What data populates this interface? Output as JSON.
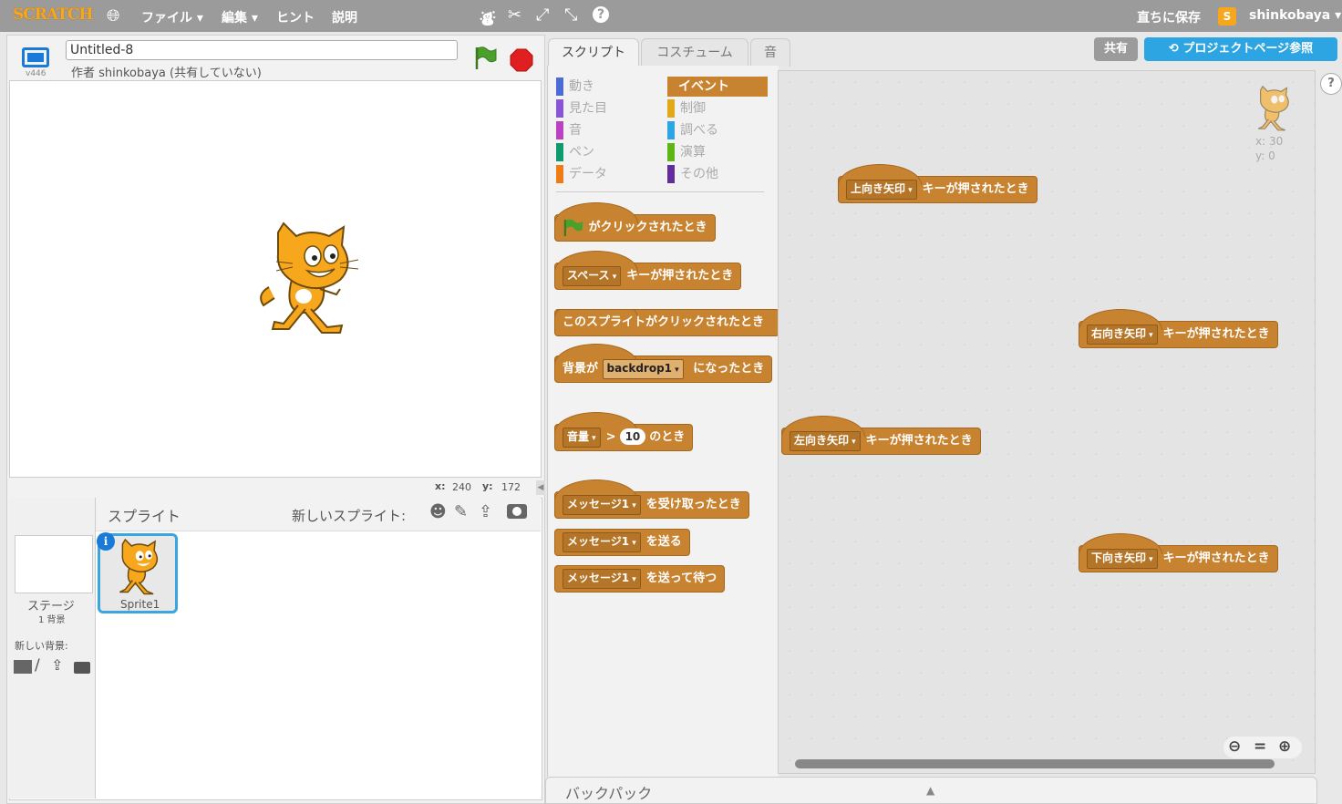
{
  "topbar": {
    "logo": "SCRATCH",
    "menus": [
      "ファイル ▾",
      "編集 ▾",
      "ヒント",
      "説明"
    ],
    "save_now": "直ちに保存",
    "username": "shinkobaya ▾"
  },
  "stage_header": {
    "version": "v446",
    "project_title": "Untitled-8",
    "author_line": "作者 shinkobaya (共有していない)"
  },
  "stage_coords": {
    "x_label": "x:",
    "x_value": "240",
    "y_label": "y:",
    "y_value": "172"
  },
  "sprites": {
    "header": "スプライト",
    "new_sprite_label": "新しいスプライト:",
    "stage_label": "ステージ",
    "stage_backdrops": "1 背景",
    "new_backdrop_label": "新しい背景:",
    "sprite_name": "Sprite1"
  },
  "tabs": [
    "スクリプト",
    "コスチューム",
    "音"
  ],
  "categories": {
    "left": [
      "動き",
      "見た目",
      "音",
      "ペン",
      "データ"
    ],
    "right": [
      "イベント",
      "制御",
      "調べる",
      "演算",
      "その他"
    ],
    "left_colors": [
      "#4a6cd4",
      "#8a55d7",
      "#bb42c3",
      "#0e9a6c",
      "#ee7d16"
    ],
    "right_colors": [
      "#c88330",
      "#e1a91a",
      "#2ca5e2",
      "#5cb712",
      "#632d99"
    ],
    "active": "イベント"
  },
  "palette_blocks": {
    "flag_clicked": "がクリックされたとき",
    "key_pressed_key": "スペース",
    "key_pressed_text": "キーが押されたとき",
    "sprite_clicked": "このスプライトがクリックされたとき",
    "backdrop_prefix": "背景が",
    "backdrop_value": "backdrop1",
    "backdrop_suffix": "になったとき",
    "sensor_value": "音量",
    "sensor_op": ">",
    "sensor_num": "10",
    "sensor_suffix": "のとき",
    "msg_value": "メッセージ1",
    "receive_text": "を受け取ったとき",
    "broadcast_text": "を送る",
    "broadcast_wait_text": "を送って待つ"
  },
  "buttons": {
    "share": "共有",
    "project_page": "プロジェクトページ参照"
  },
  "script_blocks": [
    {
      "key": "上向き矢印",
      "text": "キーが押されたとき"
    },
    {
      "key": "右向き矢印",
      "text": "キーが押されたとき"
    },
    {
      "key": "左向き矢印",
      "text": "キーが押されたとき"
    },
    {
      "key": "下向き矢印",
      "text": "キーが押されたとき"
    }
  ],
  "sprite_info": {
    "x": "x: 30",
    "y": "y: 0"
  },
  "backpack": "バックパック"
}
